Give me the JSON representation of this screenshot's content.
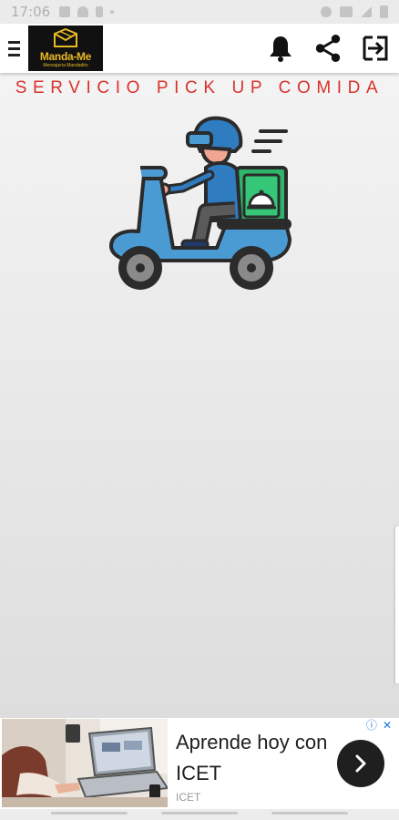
{
  "status_bar": {
    "time": "17:06"
  },
  "app_bar": {
    "logo_title": "Manda-Me",
    "logo_subtitle": "Mensajeria Mandadito",
    "icons": [
      "menu-icon",
      "bell-icon",
      "share-icon",
      "logout-icon"
    ]
  },
  "page": {
    "title": "SERVICIO PICK UP COMIDA"
  },
  "ad": {
    "headline": "Aprende hoy con ICET",
    "advertiser": "ICET",
    "info_glyph": "ⓘ",
    "close_glyph": "✕"
  },
  "colors": {
    "title_red": "#d8322c",
    "logo_gold": "#e8b923",
    "scooter_blue": "#4a9ad4",
    "box_green": "#2fb56b"
  }
}
